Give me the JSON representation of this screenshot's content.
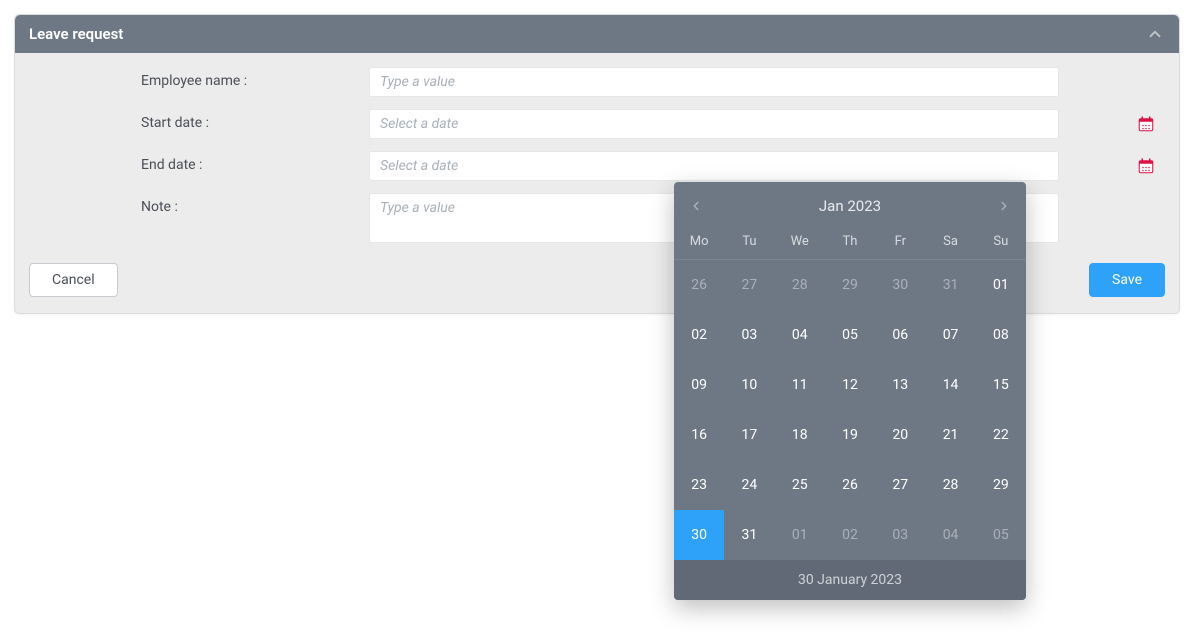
{
  "panel": {
    "title": "Leave request"
  },
  "form": {
    "employee_name": {
      "label": "Employee name :",
      "placeholder": "Type a value"
    },
    "start_date": {
      "label": "Start date :",
      "placeholder": "Select a date"
    },
    "end_date": {
      "label": "End date :",
      "placeholder": "Select a date"
    },
    "note": {
      "label": "Note :",
      "placeholder": "Type a value"
    }
  },
  "buttons": {
    "cancel": "Cancel",
    "save": "Save"
  },
  "datepicker": {
    "title": "Jan 2023",
    "dow": [
      "Mo",
      "Tu",
      "We",
      "Th",
      "Fr",
      "Sa",
      "Su"
    ],
    "footer": "30 January 2023",
    "cells": [
      {
        "d": "26",
        "out": true
      },
      {
        "d": "27",
        "out": true
      },
      {
        "d": "28",
        "out": true
      },
      {
        "d": "29",
        "out": true
      },
      {
        "d": "30",
        "out": true
      },
      {
        "d": "31",
        "out": true
      },
      {
        "d": "01"
      },
      {
        "d": "02"
      },
      {
        "d": "03"
      },
      {
        "d": "04"
      },
      {
        "d": "05"
      },
      {
        "d": "06"
      },
      {
        "d": "07"
      },
      {
        "d": "08"
      },
      {
        "d": "09"
      },
      {
        "d": "10"
      },
      {
        "d": "11"
      },
      {
        "d": "12"
      },
      {
        "d": "13"
      },
      {
        "d": "14"
      },
      {
        "d": "15"
      },
      {
        "d": "16"
      },
      {
        "d": "17"
      },
      {
        "d": "18"
      },
      {
        "d": "19"
      },
      {
        "d": "20"
      },
      {
        "d": "21"
      },
      {
        "d": "22"
      },
      {
        "d": "23"
      },
      {
        "d": "24"
      },
      {
        "d": "25"
      },
      {
        "d": "26"
      },
      {
        "d": "27"
      },
      {
        "d": "28"
      },
      {
        "d": "29"
      },
      {
        "d": "30",
        "sel": true
      },
      {
        "d": "31"
      },
      {
        "d": "01",
        "out": true
      },
      {
        "d": "02",
        "out": true
      },
      {
        "d": "03",
        "out": true
      },
      {
        "d": "04",
        "out": true
      },
      {
        "d": "05",
        "out": true
      }
    ]
  }
}
